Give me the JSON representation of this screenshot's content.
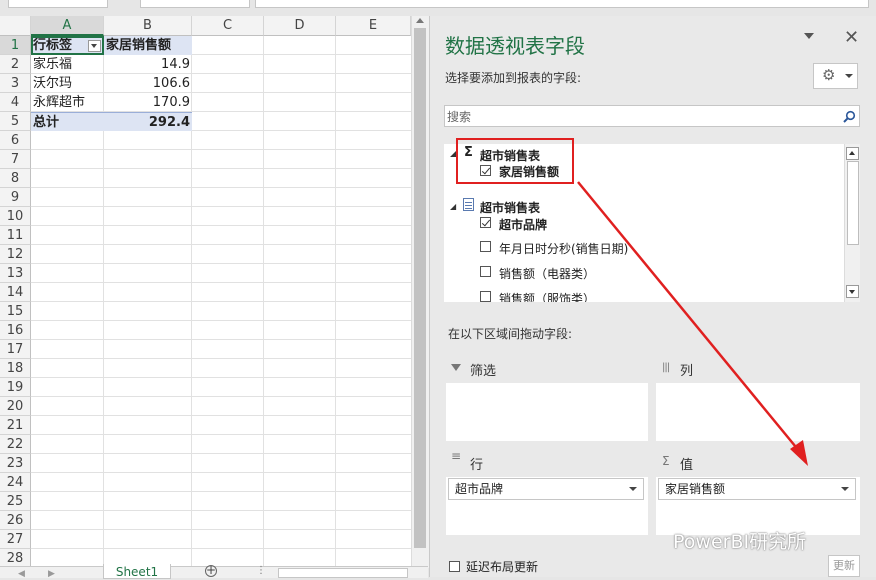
{
  "columns": [
    "A",
    "B",
    "C",
    "D",
    "E"
  ],
  "rows": [
    "1",
    "2",
    "3",
    "4",
    "5",
    "6",
    "7",
    "8",
    "9",
    "10",
    "11",
    "12",
    "13",
    "14",
    "15",
    "16",
    "17",
    "18",
    "19",
    "20",
    "21",
    "22",
    "23",
    "24",
    "25",
    "26",
    "27",
    "28"
  ],
  "pivot": {
    "header_row_label": "行标签",
    "header_value_label": "家居销售额",
    "items": [
      {
        "label": "家乐福",
        "value": "14.9"
      },
      {
        "label": "沃尔玛",
        "value": "106.6"
      },
      {
        "label": "永辉超市",
        "value": "170.9"
      }
    ],
    "total_label": "总计",
    "total_value": "292.4"
  },
  "sheet_tab": "Sheet1",
  "pane": {
    "title": "数据透视表字段",
    "subtitle": "选择要添加到报表的字段:",
    "search_placeholder": "搜索",
    "measure_group": "超市销售表",
    "measure_field": "家居销售额",
    "table_group": "超市销售表",
    "fields": [
      {
        "label": "超市品牌",
        "checked": true
      },
      {
        "label": "年月日时分秒(销售日期)",
        "checked": false
      },
      {
        "label": "销售额（电器类）",
        "checked": false
      },
      {
        "label": "销售额（服饰类）",
        "checked": false
      }
    ],
    "drag_label": "在以下区域间拖动字段:",
    "areas": {
      "filters": "筛选",
      "columns": "列",
      "rows": "行",
      "values": "值"
    },
    "rows_item": "超市品牌",
    "values_item": "家居销售额",
    "defer_label": "延迟布局更新",
    "update_button": "更新",
    "watermark": "PowerBI研究所"
  },
  "colors": {
    "accent": "#217346",
    "highlight": "#e02020",
    "pivot_fill": "#dde4f3"
  }
}
